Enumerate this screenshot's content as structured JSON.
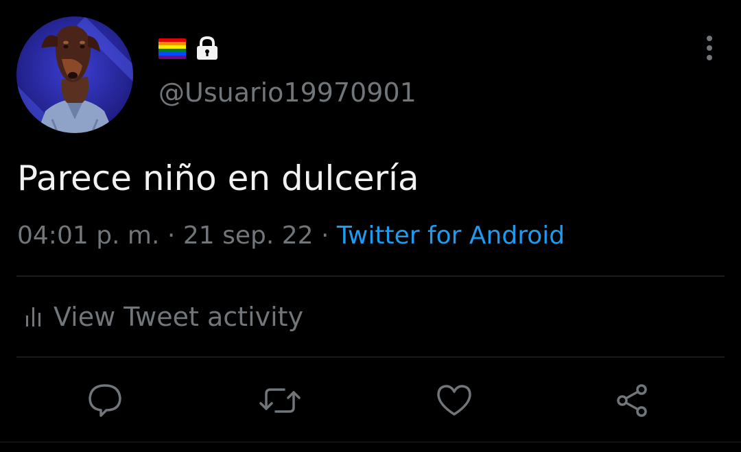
{
  "author": {
    "handle": "@Usuario19970901",
    "flag_colors": [
      "#e40303",
      "#ff8c00",
      "#ffed00",
      "#008026",
      "#004dff",
      "#750787"
    ],
    "lock_icon": "lock-icon",
    "avatar_icon": "doberman-avatar"
  },
  "tweet": {
    "text": "Parece niño en dulcería",
    "time": "04:01 p. m.",
    "separator": "·",
    "date": "21 sep. 22",
    "source": "Twitter for Android"
  },
  "activity": {
    "label": "View Tweet activity",
    "icon": "bar-chart-icon"
  },
  "actions": [
    {
      "icon": "reply-icon"
    },
    {
      "icon": "retweet-icon"
    },
    {
      "icon": "like-icon"
    },
    {
      "icon": "share-icon"
    }
  ],
  "menu": {
    "icon": "more-vertical-icon"
  },
  "colors": {
    "background": "#000000",
    "text": "#f2f2f2",
    "secondary": "#71767b",
    "link": "#1d9bf0",
    "divider": "#2f3336"
  }
}
